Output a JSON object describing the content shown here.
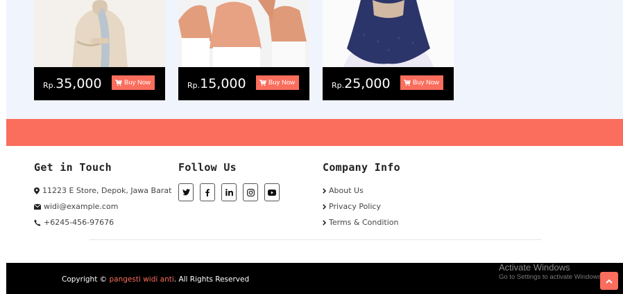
{
  "products": [
    {
      "currency": "Rp.",
      "amount": "35,000",
      "buy_label": "Buy Now"
    },
    {
      "currency": "Rp.",
      "amount": "15,000",
      "buy_label": "Buy Now"
    },
    {
      "currency": "Rp.",
      "amount": "25,000",
      "buy_label": "Buy Now"
    }
  ],
  "footer": {
    "touch": {
      "title": "Get in Touch",
      "address": "11223 E Store, Depok, Jawa Barat",
      "email": "widi@example.com",
      "phone": "+6245-456-97676"
    },
    "follow": {
      "title": "Follow Us",
      "icons": [
        "twitter-icon",
        "facebook-icon",
        "linkedin-icon",
        "instagram-icon",
        "youtube-icon"
      ]
    },
    "company": {
      "title": "Company Info",
      "links": [
        "About Us",
        "Privacy Policy",
        "Terms & Condition"
      ]
    }
  },
  "bottom": {
    "copyright_prefix": "Copyright ©",
    "brand": "pangesti widi anti",
    "copyright_suffix": ". All Rights Reserved"
  },
  "watermark": {
    "line1": "Activate Windows",
    "line2": "Go to Settings to activate Windows."
  },
  "colors": {
    "accent": "#fb6d5c",
    "section_bg": "#f0f4fc",
    "dark": "#000000"
  }
}
